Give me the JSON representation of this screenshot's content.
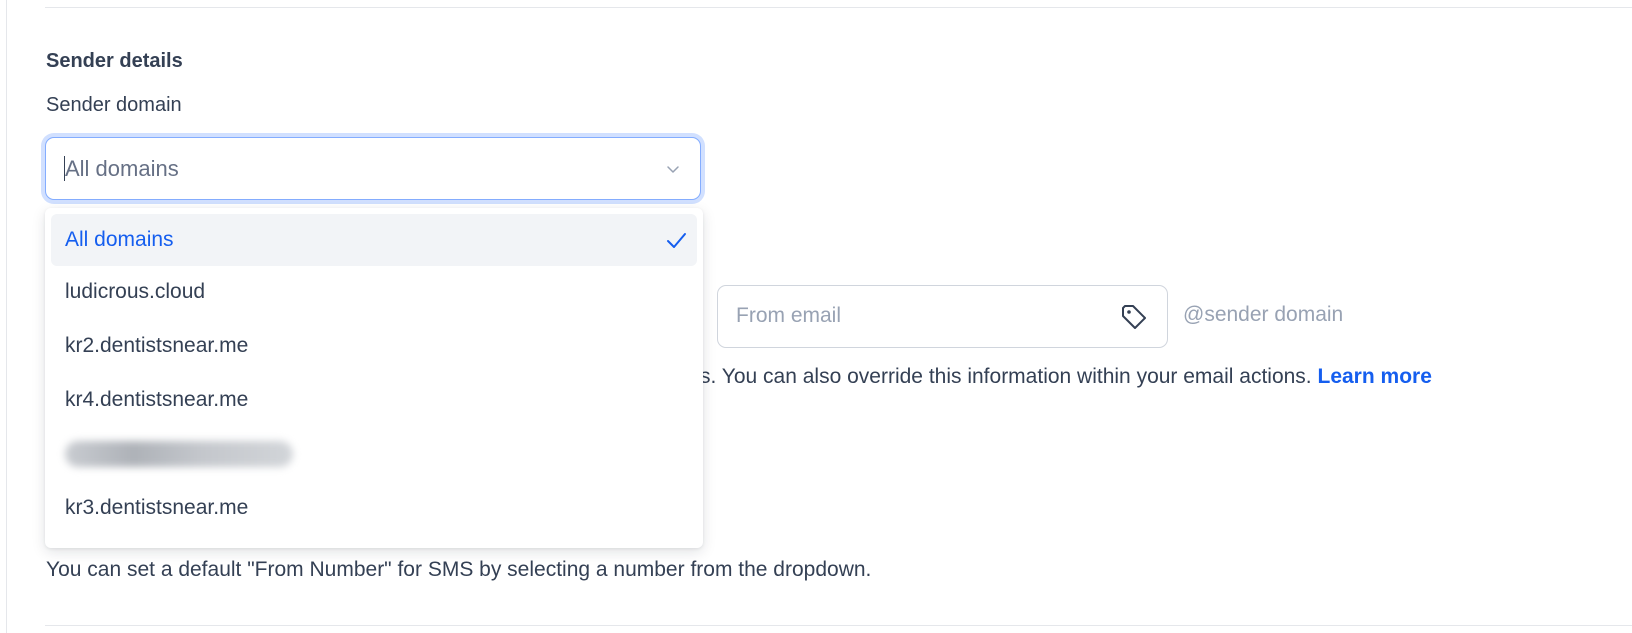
{
  "sender_details": {
    "title": "Sender details",
    "domain_label": "Sender domain",
    "domain_select": {
      "value": "All domains",
      "options": [
        {
          "label": "All domains",
          "selected": true
        },
        {
          "label": "ludicrous.cloud",
          "selected": false
        },
        {
          "label": "kr2.dentistsnear.me",
          "selected": false
        },
        {
          "label": "kr4.dentistsnear.me",
          "selected": false
        },
        {
          "label": "",
          "selected": false,
          "redacted": true
        },
        {
          "label": "kr3.dentistsnear.me",
          "selected": false
        }
      ]
    },
    "from_email": {
      "placeholder": "From email",
      "suffix": "@sender domain"
    },
    "help_text": "s. You can also override this information within your email actions.",
    "learn_more": "Learn more"
  },
  "sms": {
    "help_text": "You can set a default \"From Number\" for SMS by selecting a number from the dropdown."
  },
  "colors": {
    "accent": "#155eef",
    "focus_ring": "#d1e0ff",
    "text": "#344054",
    "muted": "#98a2b3",
    "border": "#d0d5dd"
  },
  "icons": {
    "select_chevron": "chevron-down-icon",
    "selected_check": "check-icon",
    "from_email_tag": "tag-icon"
  }
}
